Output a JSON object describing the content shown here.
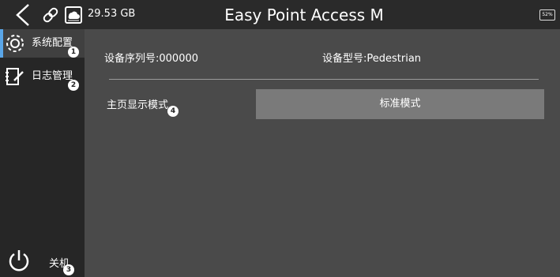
{
  "header": {
    "storage": "29.53 GB",
    "title": "Easy Point Access M",
    "battery": "52%"
  },
  "sidebar": {
    "items": [
      {
        "label": "系统配置",
        "icon": "gear-icon",
        "badge": "1",
        "active": true
      },
      {
        "label": "日志管理",
        "icon": "log-icon",
        "badge": "2",
        "active": false
      }
    ],
    "power": {
      "label": "关机",
      "icon": "power-icon",
      "badge": "3"
    }
  },
  "main": {
    "serial": "设备序列号:000000",
    "model": "设备型号:Pedestrian",
    "mode_label": "主页显示模式",
    "mode_badge": "4",
    "mode_value": "标准模式"
  },
  "colors": {
    "accent": "#5aa6e8",
    "background": "#4a4a4a",
    "sidebar": "#262626",
    "button": "#7a7a7a"
  }
}
